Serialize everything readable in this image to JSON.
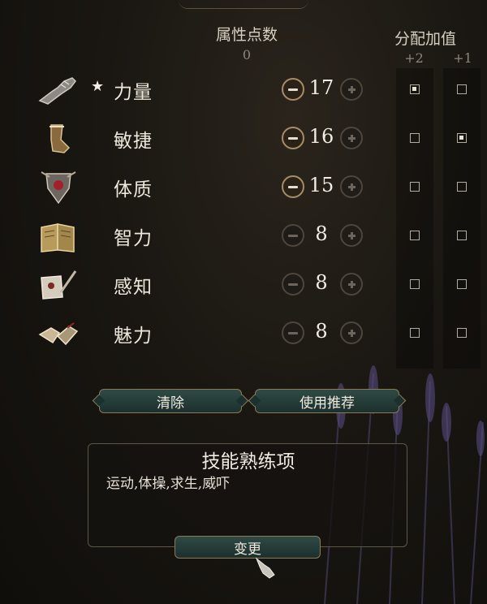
{
  "header": {
    "points_title": "属性点数",
    "points_value": "0",
    "bonus_title": "分配加值",
    "bonus_plus2": "+2",
    "bonus_plus1": "+1"
  },
  "attributes": [
    {
      "name": "力量",
      "value": "17",
      "starred": true,
      "minus_active": true,
      "bonus2": true,
      "bonus1": false,
      "icon": "gauntlet-icon"
    },
    {
      "name": "敏捷",
      "value": "16",
      "starred": false,
      "minus_active": true,
      "bonus2": false,
      "bonus1": true,
      "icon": "boot-icon"
    },
    {
      "name": "体质",
      "value": "15",
      "starred": false,
      "minus_active": true,
      "bonus2": false,
      "bonus1": false,
      "icon": "shield-heart-icon"
    },
    {
      "name": "智力",
      "value": "8",
      "starred": false,
      "minus_active": false,
      "bonus2": false,
      "bonus1": false,
      "icon": "book-icon"
    },
    {
      "name": "感知",
      "value": "8",
      "starred": false,
      "minus_active": false,
      "bonus2": false,
      "bonus1": false,
      "icon": "scroll-quill-icon"
    },
    {
      "name": "魅力",
      "value": "8",
      "starred": false,
      "minus_active": false,
      "bonus2": false,
      "bonus1": false,
      "icon": "hands-icon"
    }
  ],
  "buttons": {
    "clear": "清除",
    "recommend": "使用推荐",
    "change": "变更"
  },
  "skills": {
    "title": "技能熟练项",
    "list": "运动,体操,求生,威吓"
  },
  "star_glyph": "★",
  "colors": {
    "accent_gold": "#a88d64",
    "button_teal": "#2f4a45"
  }
}
